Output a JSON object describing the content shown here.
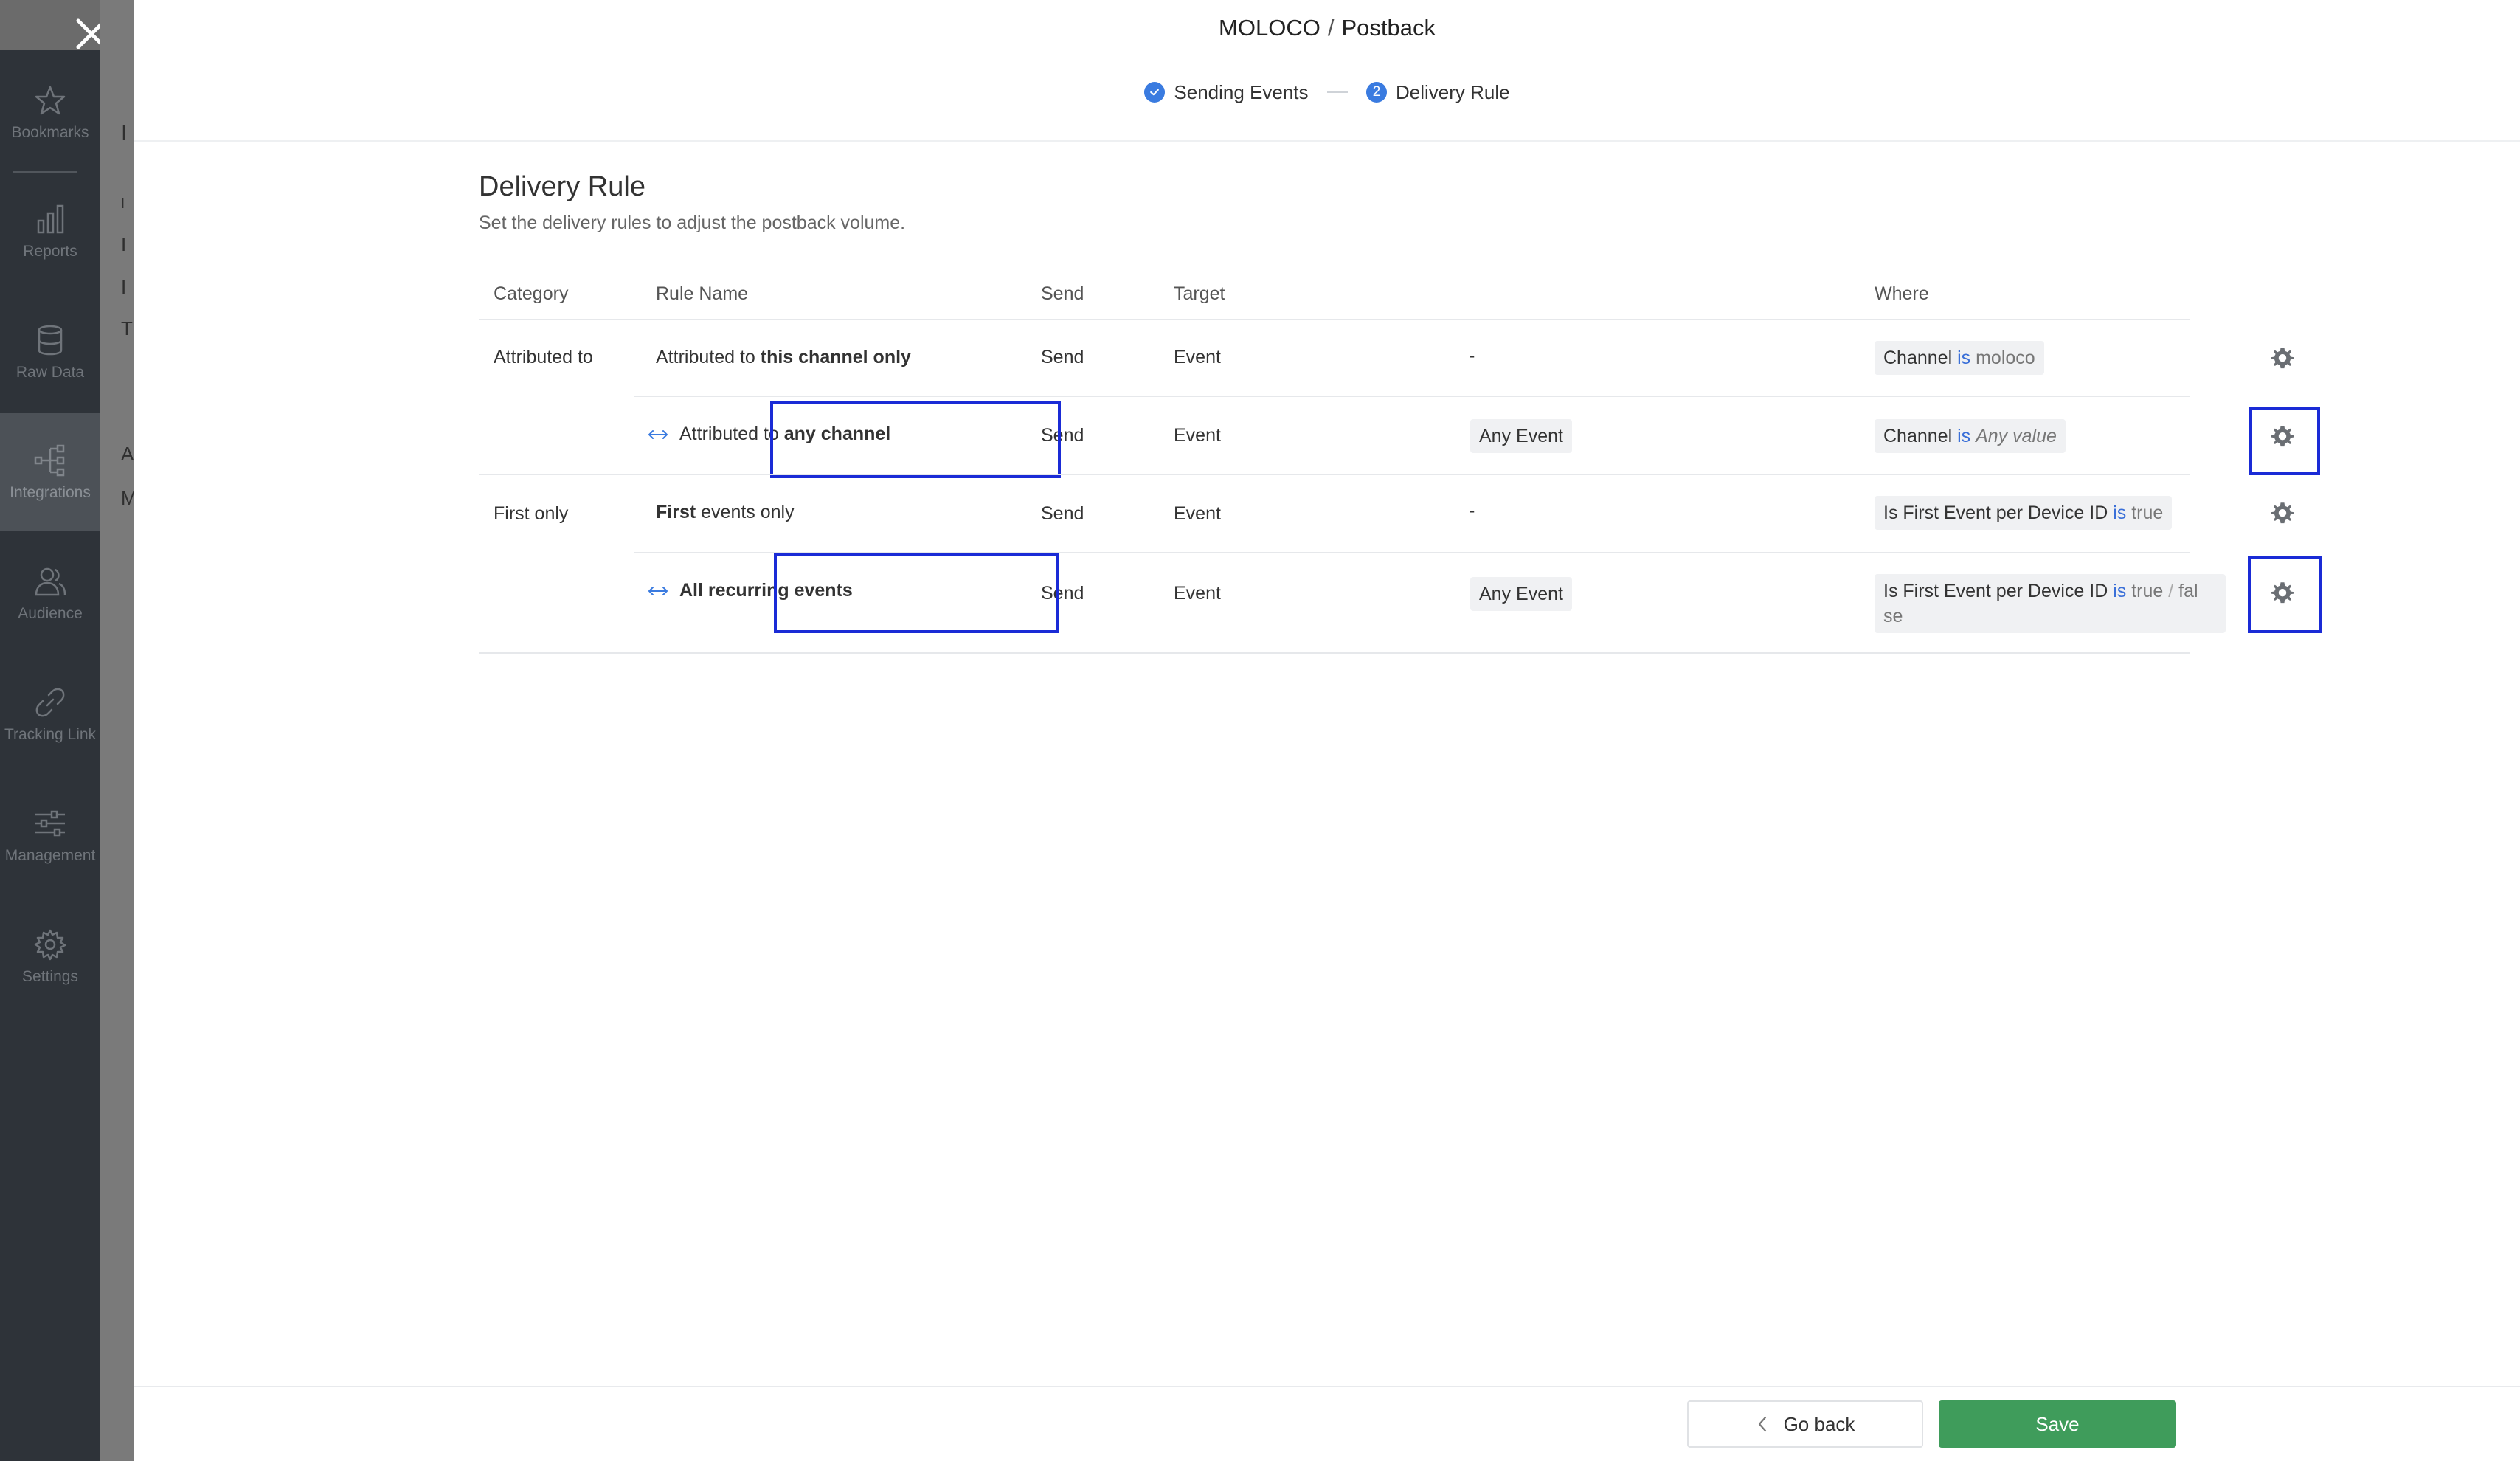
{
  "sidebar": {
    "items": [
      {
        "label": "Bookmarks",
        "icon": "star-icon"
      },
      {
        "label": "Reports",
        "icon": "bar-chart-icon"
      },
      {
        "label": "Raw Data",
        "icon": "database-icon"
      },
      {
        "label": "Integrations",
        "icon": "integrations-icon",
        "active": true
      },
      {
        "label": "Audience",
        "icon": "users-icon"
      },
      {
        "label": "Tracking Link",
        "icon": "link-icon"
      },
      {
        "label": "Management",
        "icon": "sliders-icon"
      },
      {
        "label": "Settings",
        "icon": "gear-icon"
      }
    ]
  },
  "background_page": {
    "letters": [
      "I",
      "I",
      "I",
      "I",
      "T",
      "A",
      "M"
    ]
  },
  "modal": {
    "title_partner": "MOLOCO",
    "title_sep": "/",
    "title_page": "Postback",
    "steps": [
      {
        "label": "Sending Events",
        "state": "done"
      },
      {
        "number": "2",
        "label": "Delivery Rule",
        "state": "current"
      }
    ]
  },
  "section": {
    "title": "Delivery Rule",
    "subtitle": "Set the delivery rules to adjust the postback volume."
  },
  "table": {
    "headers": {
      "category": "Category",
      "rule_name": "Rule Name",
      "send": "Send",
      "target": "Target",
      "where": "Where"
    },
    "rows": [
      {
        "category": "Attributed to",
        "rule_prefix": "Attributed to ",
        "rule_bold": "this channel only",
        "send": "Send",
        "target": "Event",
        "event": "-",
        "where_field": "Channel",
        "where_op": "is",
        "where_value": "moloco"
      },
      {
        "category": "",
        "rule_prefix": "Attributed to ",
        "rule_bold": "any channel",
        "send": "Send",
        "target": "Event",
        "event": "Any Event",
        "where_field": "Channel",
        "where_op": "is",
        "where_value": "Any value"
      },
      {
        "category": "First only",
        "rule_bold": "First",
        "rule_suffix": " events only",
        "send": "Send",
        "target": "Event",
        "event": "-",
        "where_field": "Is First Event per Device ID",
        "where_op": "is",
        "where_value": "true"
      },
      {
        "category": "",
        "rule_bold": "All recurring events",
        "send": "Send",
        "target": "Event",
        "event": "Any Event",
        "where_field": "Is First Event per Device ID",
        "where_op": "is",
        "where_value": "true",
        "where_sep": "/",
        "where_value2a": "fal",
        "where_value2b": "se"
      }
    ]
  },
  "footer": {
    "go_back": "Go back",
    "save": "Save"
  },
  "colors": {
    "accent": "#3a7be0",
    "save": "#3f9c5b",
    "highlight": "#1a2bd6",
    "sidebar": "#2e3339"
  }
}
